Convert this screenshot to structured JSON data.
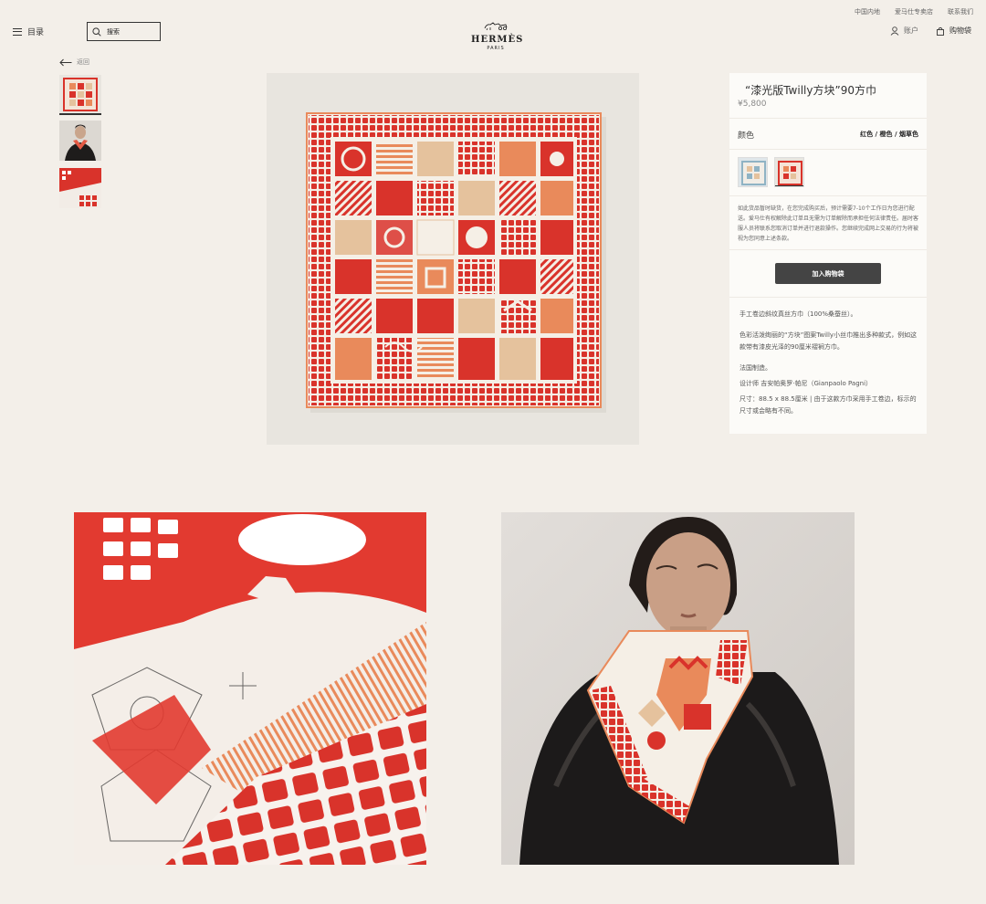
{
  "header": {
    "top_links": [
      "中国内地",
      "爱马仕专卖店",
      "联系我们"
    ],
    "menu_label": "目录",
    "search_placeholder": "搜索",
    "logo_brand": "HERMÈS",
    "logo_city": "PARIS",
    "account_label": "账户",
    "cart_label": "购物袋"
  },
  "nav": {
    "back_label": "返回"
  },
  "product": {
    "title": "“漆光版Twilly方块”90方巾",
    "price": "¥5,800",
    "color_label": "颜色",
    "color_value": "红色 / 橙色 / 烟草色",
    "notice": "如此货品暂时缺货，在您完成购买后，预计需要7-10个工作日为您进行配送。爱马仕有权解除此订单且无需为订单解除而承担任何法律责任。届时客服人员将联系您取消订单并进行退款操作。您继续完成网上交易的行为将被视为您同意上述条款。",
    "add_to_cart_label": "加入购物袋",
    "description": {
      "line1": "手工卷边斜纹真丝方巾（100%桑蚕丝）。",
      "line2": "色彩活泼绚丽的“方块”图案Twilly小丝巾推出多种款式，例如这款带有漆皮光泽的90厘米褶裥方巾。",
      "line3": "法国制造。",
      "line4": "设计师 吉安帕奥罗·帕尼（Gianpaolo Pagni）",
      "line5": "尺寸：88.5 x 88.5厘米 | 由于这款方巾采用手工卷边，标示的尺寸或会略有不同。"
    }
  },
  "colors": {
    "red": "#d9332b",
    "orange": "#e98a5b",
    "tan": "#e5c29d",
    "cream": "#f5efe6",
    "button": "#444444",
    "background": "#f3efe9"
  },
  "icons": [
    "menu-icon",
    "search-icon",
    "account-icon",
    "cart-icon",
    "back-arrow-icon"
  ]
}
